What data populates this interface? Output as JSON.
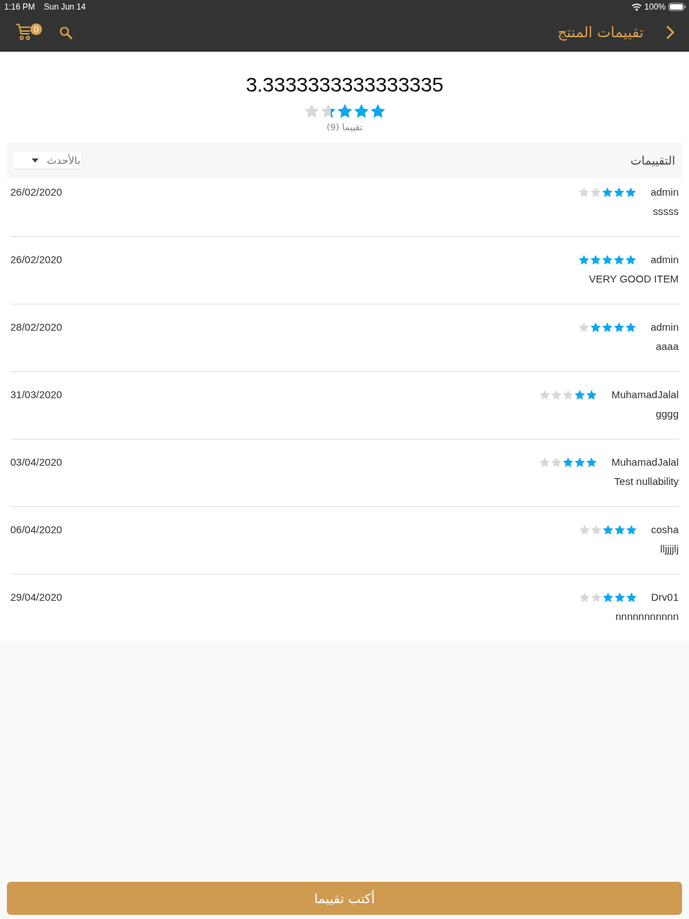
{
  "status_bar": {
    "time": "1:16 PM",
    "date": "Sun Jun 14",
    "battery": "100%"
  },
  "nav_bar": {
    "title": "تقييمات المنتج",
    "cart_count": "0"
  },
  "summary": {
    "average": "3.3333333333333335",
    "stars": 3.33,
    "count": "(9) تقييما"
  },
  "reviews_header": {
    "title": "التقييمات",
    "sort": {
      "value": "بالأحدث"
    }
  },
  "reviews": [
    {
      "date": "26/02/2020",
      "author": "admin",
      "stars": 3,
      "comment": "sssss"
    },
    {
      "date": "26/02/2020",
      "author": "admin",
      "stars": 5,
      "comment": "VERY GOOD ITEM"
    },
    {
      "date": "28/02/2020",
      "author": "admin",
      "stars": 4,
      "comment": "aaaa"
    },
    {
      "date": "31/03/2020",
      "author": "MuhamadJalal",
      "stars": 2,
      "comment": "gggg"
    },
    {
      "date": "03/04/2020",
      "author": "MuhamadJalal",
      "stars": 3,
      "comment": "Test nullability"
    },
    {
      "date": "06/04/2020",
      "author": "cosha",
      "stars": 3,
      "comment": "lljjjjlj"
    },
    {
      "date": "29/04/2020",
      "author": "Drv01",
      "stars": 3,
      "comment": "nnnnnnnnnnn"
    }
  ],
  "write_button": {
    "label": "أكتب تقييما"
  }
}
